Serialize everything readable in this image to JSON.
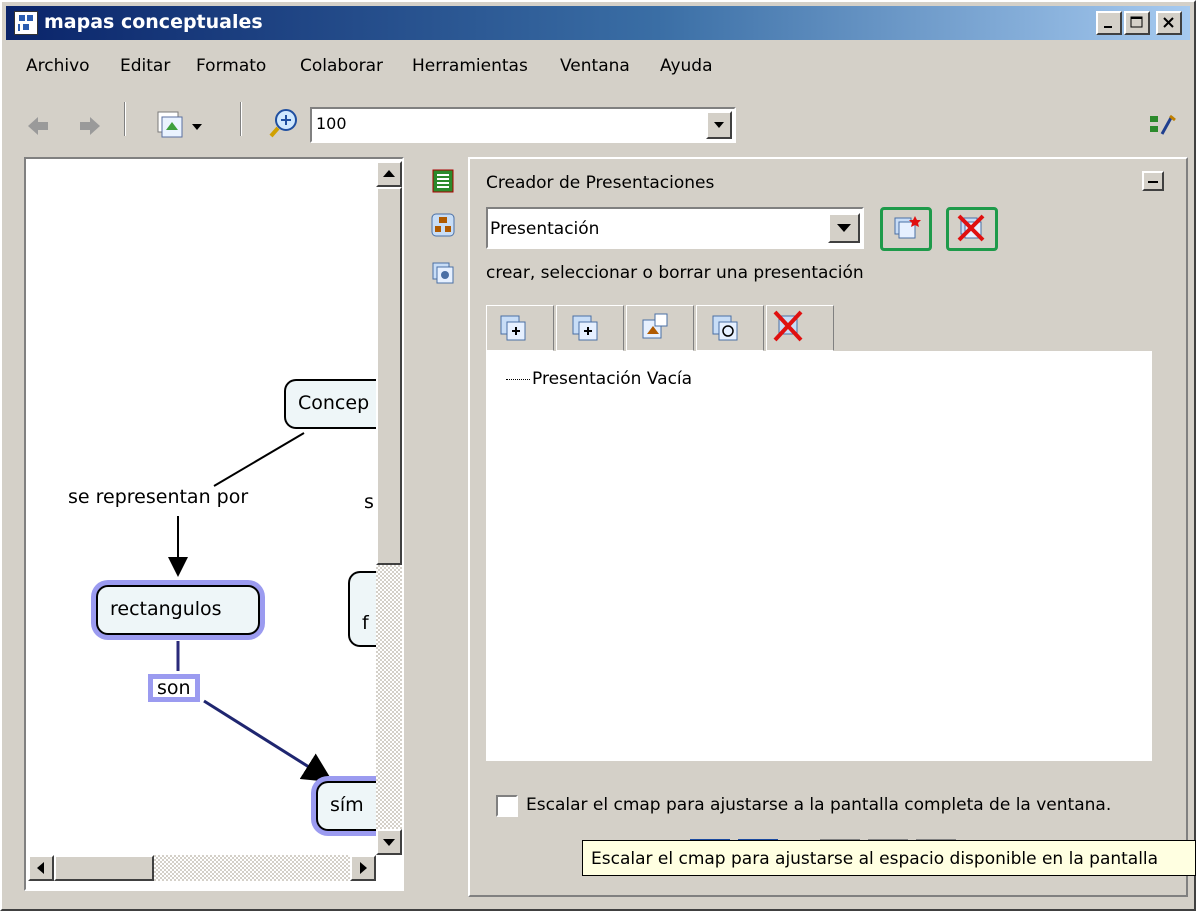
{
  "window": {
    "title": "mapas conceptuales",
    "controls": [
      "minimize-icon",
      "maximize-icon",
      "close-icon"
    ]
  },
  "menu": [
    "Archivo",
    "Editar",
    "Formato",
    "Colaborar",
    "Herramientas",
    "Ventana",
    "Ayuda"
  ],
  "toolbar": {
    "zoom_value": "100",
    "icons": [
      "back-arrow-icon",
      "forward-arrow-icon",
      "view-icon",
      "zoom-icon",
      "style-icon"
    ]
  },
  "map": {
    "nodes": {
      "concept": "Concep",
      "rectangulos": "rectangulos",
      "symbols": "sím",
      "partial_f": "f"
    },
    "links": {
      "se_representan_por": "se representan por",
      "son": "son",
      "partial_s": "s"
    }
  },
  "panel": {
    "title": "Creador de Presentaciones",
    "presentation_select": "Presentación",
    "hint": "crear, seleccionar o borrar una presentación",
    "tree_item": "Presentación Vacía",
    "checkbox_label": "Escalar el cmap para ajustarse a la pantalla completa de la ventana.",
    "checkbox_checked": false
  },
  "tooltip": "Escalar el cmap para ajustarse al espacio disponible en la pantalla",
  "colors": {
    "title_start": "#0a246a",
    "title_end": "#a6caf0",
    "selection_halo": "#9b9bf0",
    "node_fill": "#eef6f8",
    "button_border": "#1e9a4a",
    "delete_red": "#e01010"
  }
}
